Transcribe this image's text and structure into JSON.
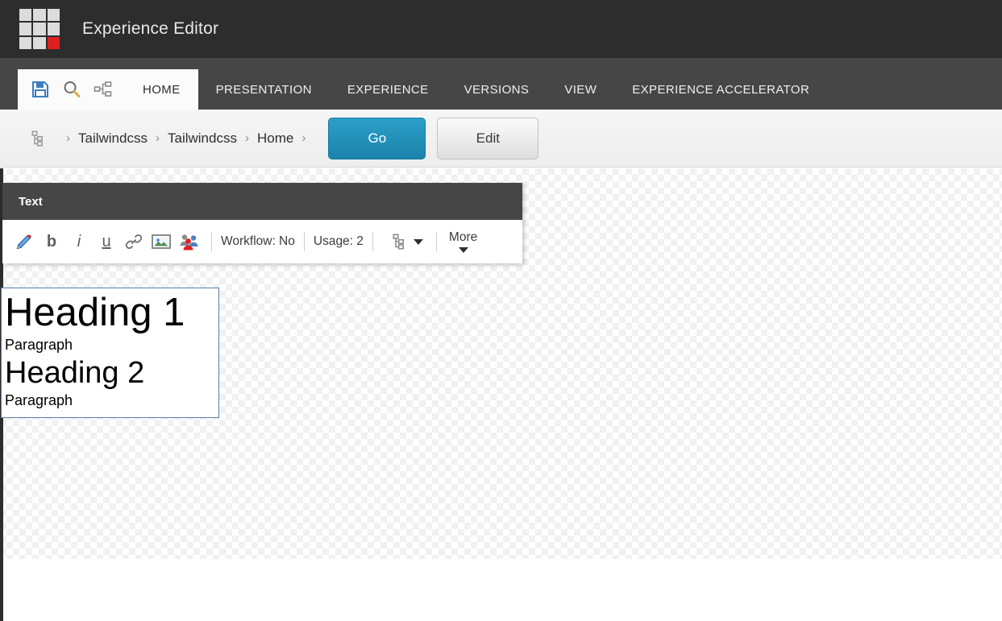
{
  "brand": {
    "title": "Experience Editor",
    "logo_icon": "sitecore-grid-logo",
    "logo_accent_color": "#e02020"
  },
  "quickbar": {
    "items": [
      {
        "name": "save-icon",
        "label": "Save"
      },
      {
        "name": "search-icon",
        "label": "Search"
      },
      {
        "name": "navigate-tree-icon",
        "label": "Navigate"
      }
    ]
  },
  "ribbon": {
    "tabs": [
      {
        "label": "HOME",
        "active": true
      },
      {
        "label": "PRESENTATION",
        "active": false
      },
      {
        "label": "EXPERIENCE",
        "active": false
      },
      {
        "label": "VERSIONS",
        "active": false
      },
      {
        "label": "VIEW",
        "active": false
      },
      {
        "label": "EXPERIENCE ACCELERATOR",
        "active": false
      }
    ]
  },
  "navbar": {
    "tree_icon": "content-tree-icon",
    "separator": "›",
    "crumbs": [
      "Tailwindcss",
      "Tailwindcss",
      "Home"
    ],
    "go_label": "Go",
    "edit_label": "Edit",
    "go_color": "#1b82aa"
  },
  "fieldbar": {
    "title": "Text",
    "tools": [
      {
        "name": "edit-pencil-icon",
        "label": "Edit"
      },
      {
        "name": "bold-icon",
        "label": "b"
      },
      {
        "name": "italic-icon",
        "label": "i"
      },
      {
        "name": "underline-icon",
        "label": "u"
      },
      {
        "name": "insert-link-icon",
        "label": "Insert link"
      },
      {
        "name": "insert-image-icon",
        "label": "Insert image"
      },
      {
        "name": "personalize-icon",
        "label": "Personalize"
      }
    ],
    "workflow_label": "Workflow: No",
    "usage_label": "Usage: 2",
    "tree_icon": "related-items-tree-icon",
    "more_label": "More"
  },
  "content": {
    "heading1": "Heading 1",
    "paragraph1": "Paragraph",
    "heading2": "Heading 2",
    "paragraph2": "Paragraph",
    "border_color": "#5b7fa8"
  }
}
